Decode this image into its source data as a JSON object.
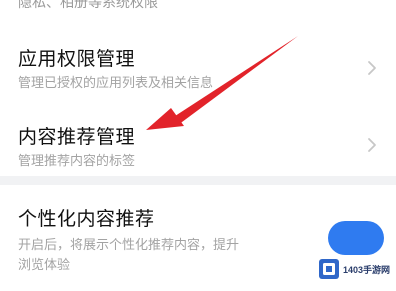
{
  "top_partial_text": "隐私、相册等系统权限",
  "rows": [
    {
      "title": "应用权限管理",
      "subtitle": "管理已授权的应用列表及相关信息"
    },
    {
      "title": "内容推荐管理",
      "subtitle": "管理推荐内容的标签"
    }
  ],
  "personalized": {
    "title": "个性化内容推荐",
    "subtitle_line1": "开启后，将展示个性化推荐内容，提升",
    "subtitle_line2": "浏览体验",
    "toggle_on": true
  },
  "annotation": {
    "arrow_color": "#e2232a"
  },
  "watermark": {
    "text": "1403手游网"
  }
}
